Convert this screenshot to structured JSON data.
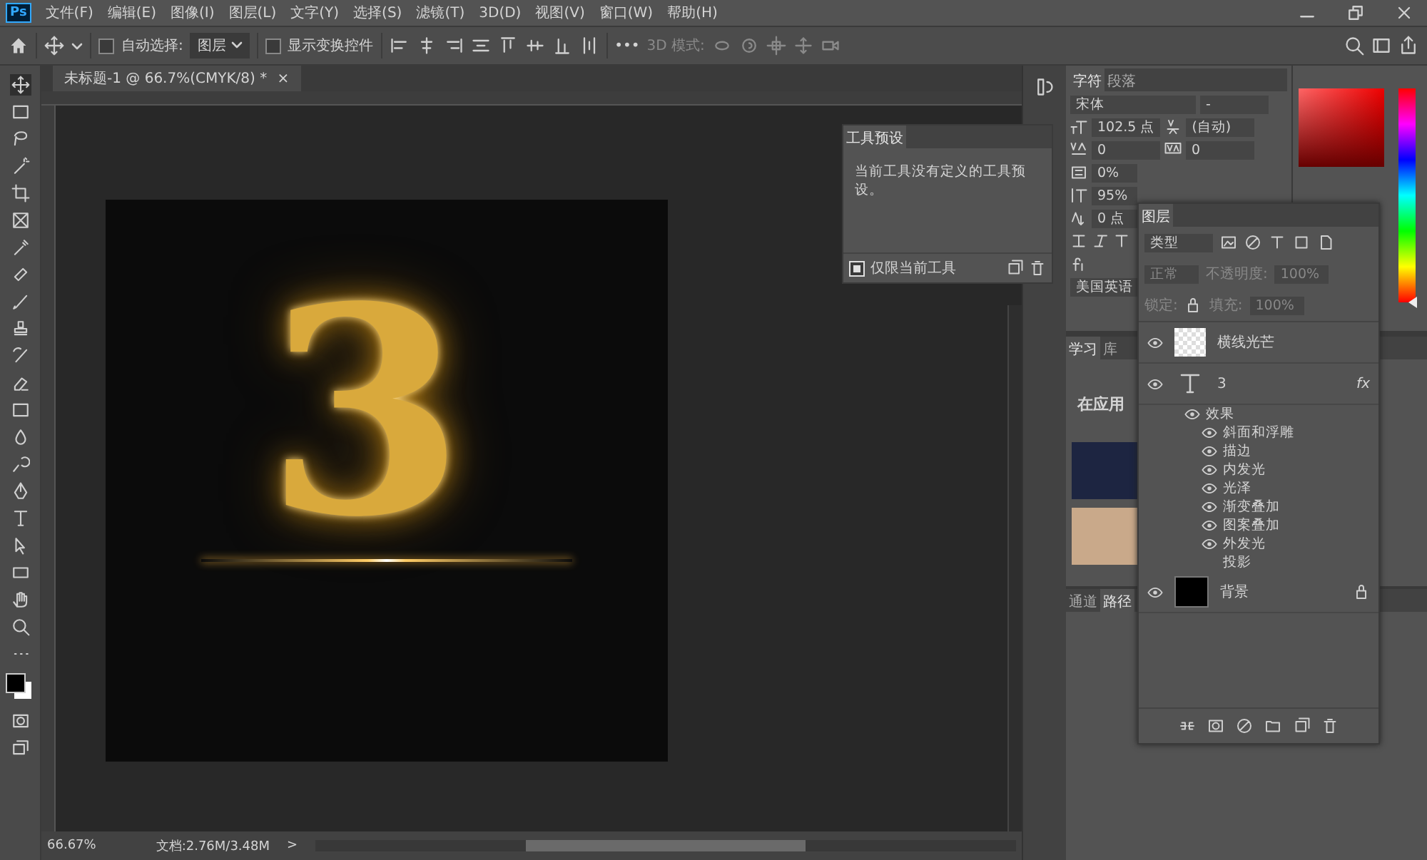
{
  "menu_bar": {
    "app_icon": "Ps",
    "items": [
      "文件(F)",
      "编辑(E)",
      "图像(I)",
      "图层(L)",
      "文字(Y)",
      "选择(S)",
      "滤镜(T)",
      "3D(D)",
      "视图(V)",
      "窗口(W)",
      "帮助(H)"
    ]
  },
  "options_bar": {
    "auto_select": {
      "label": "自动选择:",
      "checked": false
    },
    "target": "图层",
    "transform_controls": {
      "label": "显示变换控件",
      "checked": false
    },
    "more": "•••",
    "mode_3d": "3D 模式:"
  },
  "document": {
    "tab": "未标题-1 @ 66.7%(CMYK/8) *",
    "close": "×",
    "canvas_text": "3",
    "status": {
      "zoom": "66.67%",
      "doc": "文档:2.76M/3.48M",
      "arrow": ">"
    }
  },
  "tool_presets": {
    "tab": "工具预设",
    "message": "当前工具没有定义的工具预设。",
    "current_only": {
      "label": "仅限当前工具",
      "checked": true
    }
  },
  "character": {
    "tabs": [
      {
        "label": "字符",
        "selected": true
      },
      {
        "label": "段落",
        "selected": false
      }
    ],
    "font": "宋体",
    "style": "-",
    "size": "102.5 点",
    "leading": "(自动)",
    "kerning": "0",
    "tracking": "0",
    "proportional": "0%",
    "vertical_scale": "95%",
    "baseline": "0 点",
    "language": "美国英语"
  },
  "color_panel": {
    "hue": {
      "level": 0
    }
  },
  "learn": {
    "tabs": [
      {
        "label": "学习",
        "selected": true
      },
      {
        "label": "库",
        "selected": false
      }
    ],
    "heading": "在应用"
  },
  "bottom_panel": {
    "tabs": [
      {
        "label": "通道",
        "selected": false
      },
      {
        "label": "路径",
        "selected": true
      }
    ]
  },
  "layers": {
    "tab": "图层",
    "filter": "类型",
    "blend": "正常",
    "opacity_label": "不透明度:",
    "opacity": "100%",
    "lock_label": "锁定:",
    "fill_label": "填充:",
    "fill": "100%",
    "items": [
      {
        "kind": "image",
        "name": "横线光芒",
        "visible": true,
        "locked": false
      },
      {
        "kind": "text",
        "name": "3",
        "visible": true,
        "locked": false,
        "fx": "fx",
        "effects_label": "效果",
        "effects": [
          {
            "name": "斜面和浮雕",
            "visible": true
          },
          {
            "name": "描边",
            "visible": true
          },
          {
            "name": "内发光",
            "visible": true
          },
          {
            "name": "光泽",
            "visible": true
          },
          {
            "name": "渐变叠加",
            "visible": true
          },
          {
            "name": "图案叠加",
            "visible": true
          },
          {
            "name": "外发光",
            "visible": true
          },
          {
            "name": "投影",
            "visible": false
          }
        ]
      },
      {
        "kind": "fill",
        "name": "背景",
        "visible": true,
        "locked": true
      }
    ]
  }
}
